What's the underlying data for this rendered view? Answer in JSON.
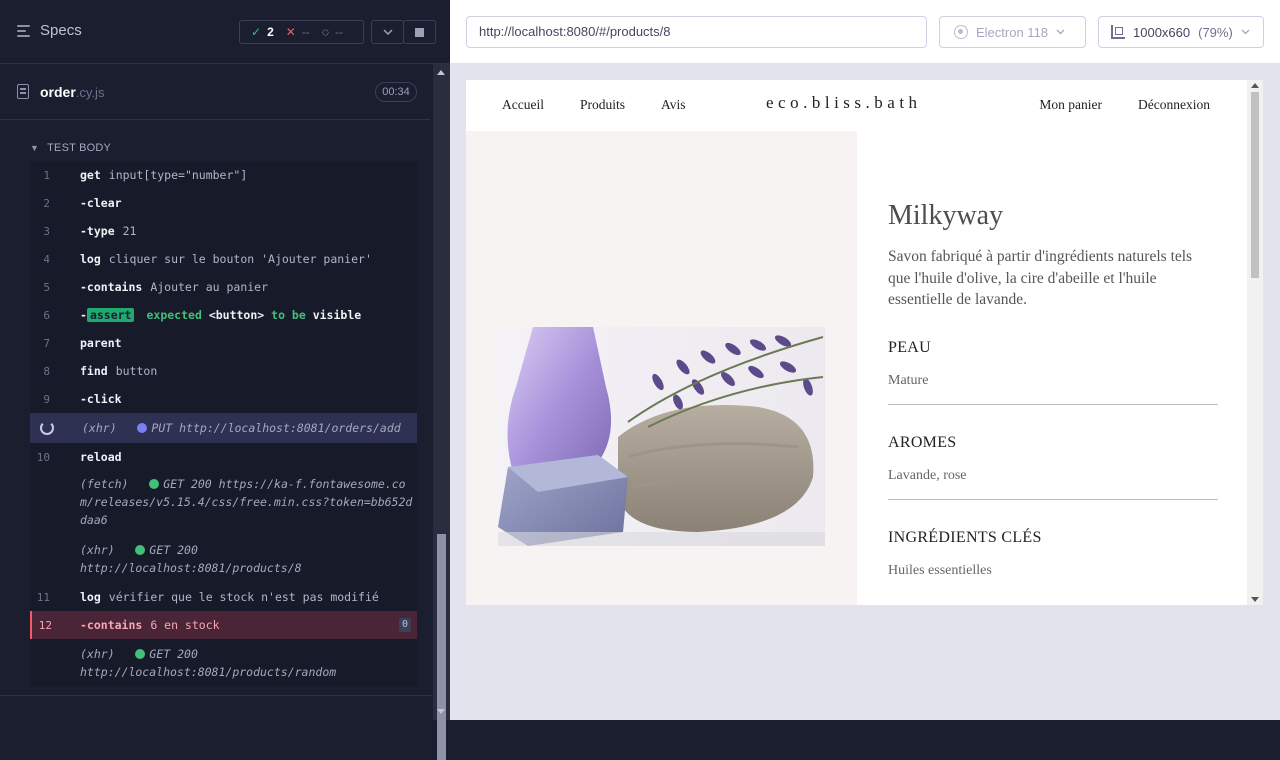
{
  "runner": {
    "specs_label": "Specs",
    "stats": {
      "passed_icon": "✓",
      "passed": "2",
      "failed_icon": "✕",
      "failed": "--",
      "pending_icon": "◌",
      "pending": "--"
    },
    "controls": {
      "collapse_icon": "chevron-down-icon",
      "stop_icon": "stop-icon"
    },
    "file": {
      "name": "order",
      "ext": ".cy.js",
      "duration": "00:34"
    },
    "section_title": "TEST BODY",
    "commands": [
      {
        "num": "1",
        "name": "get",
        "arg": "input[type=\"number\"]"
      },
      {
        "num": "2",
        "name": "-clear",
        "arg": ""
      },
      {
        "num": "3",
        "name": "-type",
        "arg": "21"
      },
      {
        "num": "4",
        "name": "log",
        "arg": "cliquer sur le bouton 'Ajouter panier'"
      },
      {
        "num": "5",
        "name": "-contains",
        "arg": "Ajouter au panier"
      },
      {
        "num": "6",
        "name": "-",
        "assert_chip": "assert",
        "expected": "expected",
        "subject": "<button>",
        "to_be": "to be",
        "visible": "visible"
      },
      {
        "num": "7",
        "name": "parent",
        "arg": ""
      },
      {
        "num": "8",
        "name": "find",
        "arg": "button"
      },
      {
        "num": "9",
        "name": "-click",
        "arg": ""
      },
      {
        "num": "",
        "kind": "(xhr)",
        "method": "PUT",
        "url": "http://localhost:8081/orders/add"
      },
      {
        "num": "10",
        "name": "reload",
        "arg": ""
      },
      {
        "kind": "(fetch)",
        "status": "GET 200",
        "url": "https://ka-f.fontawesome.com/releases/v5.15.4/css/free.min.css?token=bb652ddaa6"
      },
      {
        "kind": "(xhr)",
        "status": "GET 200",
        "url": "http://localhost:8081/products/8"
      },
      {
        "num": "11",
        "name": "log",
        "arg": "vérifier que le stock n'est pas modifié"
      },
      {
        "num": "12",
        "name": "-contains",
        "arg": "6 en stock",
        "badge": "0"
      },
      {
        "kind": "(xhr)",
        "status": "GET 200",
        "url": "http://localhost:8081/products/random"
      }
    ]
  },
  "preview": {
    "url": "http://localhost:8080/#/products/8",
    "browser": "Electron 118",
    "viewport": "1000x660",
    "zoom": "(79%)"
  },
  "app": {
    "nav_left": [
      "Accueil",
      "Produits",
      "Avis"
    ],
    "brand": "eco.bliss.bath",
    "nav_right": [
      "Mon panier",
      "Déconnexion"
    ],
    "product": {
      "title": "Milkyway",
      "description": "Savon fabriqué à partir d'ingrédients naturels tels que l'huile d'olive, la cire d'abeille et l'huile essentielle de lavande.",
      "sections": [
        {
          "heading": "PEAU",
          "value": "Mature"
        },
        {
          "heading": "AROMES",
          "value": "Lavande, rose"
        },
        {
          "heading": "INGRÉDIENTS CLÉS",
          "value": "Huiles essentielles"
        }
      ]
    }
  },
  "colors": {
    "pass": "#43c07a",
    "fail": "#f25a6c",
    "runner_bg": "#1b1e2e",
    "pending_req": "#7b7ff0"
  }
}
